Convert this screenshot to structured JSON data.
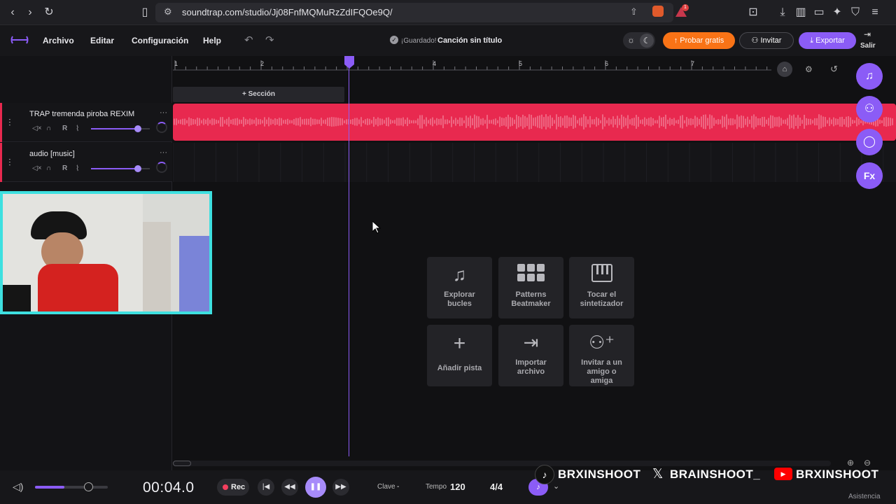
{
  "browser": {
    "url": "soundtrap.com/studio/Jj08FnfMQMuRzZdIFQOe9Q/",
    "badge_count": "1"
  },
  "header": {
    "menu": [
      "Archivo",
      "Editar",
      "Configuración",
      "Help"
    ],
    "saved_status": "¡Guardado!",
    "song_title": "Canción sin título",
    "try_free": "Probar gratis",
    "invite": "Invitar",
    "export": "Exportar",
    "exit": "Salir"
  },
  "ruler": {
    "ticks": [
      "1",
      "2",
      "4",
      "5",
      "6",
      "7"
    ]
  },
  "section_button": "Sección",
  "tracks": [
    {
      "name": "TRAP tremenda piroba REXIM",
      "r_label": "R",
      "volume": 0.8
    },
    {
      "name": "audio [music]",
      "r_label": "R",
      "volume": 0.8
    }
  ],
  "tiles": [
    {
      "label": "Explorar bucles",
      "icon": "music-note-icon"
    },
    {
      "label": "Patterns Beatmaker",
      "icon": "grid-icon"
    },
    {
      "label": "Tocar el sintetizador",
      "icon": "piano-icon"
    },
    {
      "label": "Añadir pista",
      "icon": "plus-icon"
    },
    {
      "label": "Importar archivo",
      "icon": "import-icon"
    },
    {
      "label": "Invitar a un amigo o amiga",
      "icon": "add-user-icon"
    }
  ],
  "side_buttons": [
    "music-icon",
    "users-icon",
    "chat-icon",
    "fx-icon"
  ],
  "side_fx_label": "Fx",
  "transport": {
    "time": "00:04.0",
    "rec": "Rec",
    "key_label": "Clave",
    "key_value": "-",
    "tempo_label": "Tempo",
    "tempo_value": "120",
    "signature": "4/4",
    "master_volume": 0.4
  },
  "help": "Asistencia",
  "overlay": {
    "socials": [
      "BRXINSHOOT",
      "BRAINSHOOT_",
      "BRXINSHOOT"
    ]
  },
  "colors": {
    "accent": "#8b5cf6",
    "orange": "#f97316",
    "track_red": "#e8294f"
  }
}
